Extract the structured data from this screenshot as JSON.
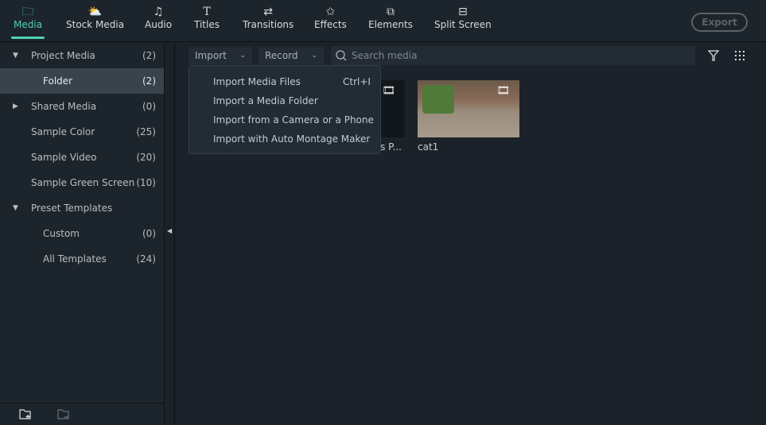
{
  "tabs": [
    {
      "label": "Media",
      "icon": "folder-icon",
      "active": true
    },
    {
      "label": "Stock Media",
      "icon": "cloud-folder-icon"
    },
    {
      "label": "Audio",
      "icon": "music-note-icon"
    },
    {
      "label": "Titles",
      "icon": "text-t-icon"
    },
    {
      "label": "Transitions",
      "icon": "transition-icon"
    },
    {
      "label": "Effects",
      "icon": "magic-star-icon"
    },
    {
      "label": "Elements",
      "icon": "layers-icon"
    },
    {
      "label": "Split Screen",
      "icon": "split-screen-icon"
    }
  ],
  "export_label": "Export",
  "sidebar": {
    "items": [
      {
        "label": "Project Media",
        "count": "(2)",
        "arrow": "▼"
      },
      {
        "label": "Folder",
        "count": "(2)",
        "selected": true
      },
      {
        "label": "Shared Media",
        "count": "(0)",
        "arrow": "▶"
      },
      {
        "label": "Sample Color",
        "count": "(25)"
      },
      {
        "label": "Sample Video",
        "count": "(20)"
      },
      {
        "label": "Sample Green Screen",
        "count": "(10)"
      },
      {
        "label": "Preset Templates",
        "count": "",
        "arrow": "▼"
      },
      {
        "label": "Custom",
        "count": "(0)"
      },
      {
        "label": "All Templates",
        "count": "(24)"
      }
    ]
  },
  "toolbar": {
    "import": "Import",
    "record": "Record",
    "search_placeholder": "Search media"
  },
  "media": [
    {
      "label": "s P..."
    },
    {
      "label": "cat1"
    }
  ],
  "import_menu": [
    {
      "label": "Import Media Files",
      "shortcut": "Ctrl+I"
    },
    {
      "label": "Import a Media Folder"
    },
    {
      "label": "Import from a Camera or a Phone"
    },
    {
      "label": "Import with Auto Montage Maker"
    }
  ],
  "accent": "#4fd1b5"
}
